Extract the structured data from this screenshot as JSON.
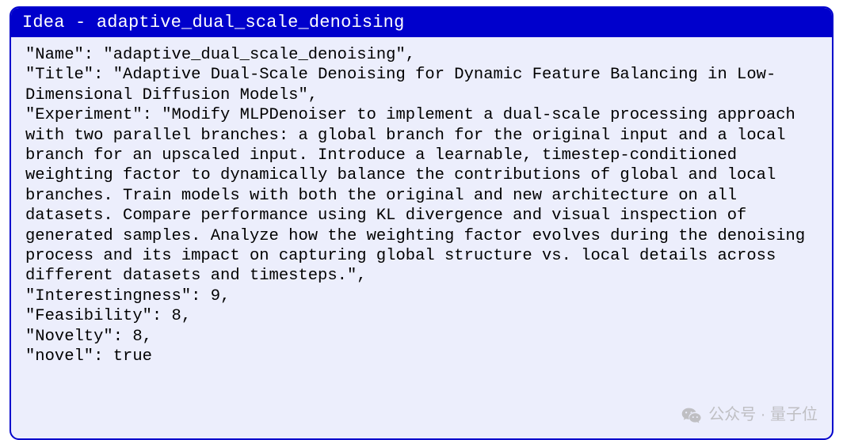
{
  "card": {
    "header_prefix": "Idea - ",
    "header_name": "adaptive_dual_scale_denoising",
    "fields": {
      "Name": "adaptive_dual_scale_denoising",
      "Title": "Adaptive Dual-Scale Denoising for Dynamic Feature Balancing in Low-Dimensional Diffusion Models",
      "Experiment": "Modify MLPDenoiser to implement a dual-scale processing approach with two parallel branches: a global branch for the original input and a local branch for an upscaled input. Introduce a learnable, timestep-conditioned weighting factor to dynamically balance the contributions of global and local branches. Train models with both the original and new architecture on all datasets. Compare performance using KL divergence and visual inspection of generated samples. Analyze how the weighting factor evolves during the denoising process and its impact on capturing global structure vs. local details across different datasets and timesteps.",
      "Interestingness": 9,
      "Feasibility": 8,
      "Novelty": 8,
      "novel": true
    }
  },
  "watermark": {
    "text": "公众号 · 量子位"
  }
}
